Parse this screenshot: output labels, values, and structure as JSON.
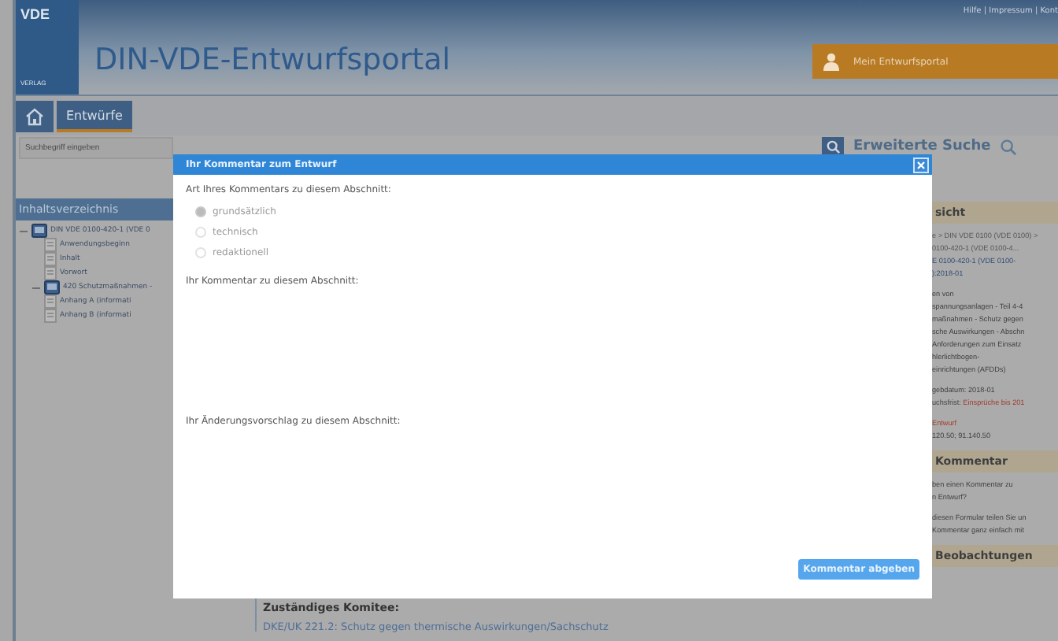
{
  "header": {
    "logo": {
      "top": "VDE",
      "bottom": "VERLAG"
    },
    "title": "DIN-VDE-Entwurfsportal",
    "top_links": "Hilfe | Impressum | Kont",
    "account_button": "Mein Entwurfsportal"
  },
  "nav": [
    {
      "kind": "home",
      "selected": false
    },
    {
      "kind": "tab",
      "label": "Entwürfe",
      "selected": true
    }
  ],
  "search": {
    "placeholder": "Suchbegriff eingeben",
    "advanced": "Erweiterte Suche"
  },
  "sidebar": {
    "title": "Inhaltsverzeichnis",
    "tree": [
      {
        "label": "DIN VDE 0100-420-1 (VDE 0",
        "kind": "document",
        "expanded": true,
        "children": [
          {
            "label": "Anwendungsbeginn",
            "kind": "page"
          },
          {
            "label": "Inhalt",
            "kind": "page"
          },
          {
            "label": "Vorwort",
            "kind": "page"
          },
          {
            "label": "420 Schutzmaßnahmen -",
            "kind": "document",
            "expanded": true
          },
          {
            "label": "Anhang A (informati",
            "kind": "page"
          },
          {
            "label": "Anhang B (informati",
            "kind": "page"
          }
        ]
      }
    ]
  },
  "right_panel": [
    {
      "title": "sicht",
      "lines": [
        {
          "kind": "muted",
          "text": "e > DIN VDE 0100 (VDE 0100) >"
        },
        {
          "kind": "muted",
          "text": "0100-420-1 (VDE 0100-4..."
        },
        {
          "kind": "link",
          "text": "E 0100-420-1 (VDE 0100-"
        },
        {
          "kind": "link",
          "text": "):2018-01"
        },
        {
          "kind": "gap"
        },
        {
          "kind": "text",
          "text": "en von"
        },
        {
          "kind": "text",
          "text": "spannungsanlagen - Teil 4-4"
        },
        {
          "kind": "text",
          "text": "maßnahmen - Schutz gegen"
        },
        {
          "kind": "text",
          "text": "sche Auswirkungen - Abschn"
        },
        {
          "kind": "text",
          "text": "Anforderungen zum Einsatz"
        },
        {
          "kind": "text",
          "text": "hlerlichtbogen-"
        },
        {
          "kind": "text",
          "text": "einrichtungen (AFDDs)"
        },
        {
          "kind": "gap"
        },
        {
          "kind": "text",
          "text": "gebdatum: 2018-01"
        },
        {
          "kind": "deadline",
          "text": "uchsfrist: ",
          "value": "Einsprüche bis 201"
        },
        {
          "kind": "gap"
        },
        {
          "kind": "warning",
          "text": "Entwurf"
        },
        {
          "kind": "text",
          "text": "120.50; 91.140.50"
        }
      ]
    },
    {
      "title": "Kommentar",
      "lines": [
        {
          "kind": "text",
          "text": "ben einen Kommentar zu"
        },
        {
          "kind": "text",
          "text": "n Entwurf?"
        },
        {
          "kind": "gap"
        },
        {
          "kind": "text",
          "text": "diesen Formular teilen Sie un"
        },
        {
          "kind": "text",
          "text": "Kommentar ganz einfach mit"
        }
      ]
    },
    {
      "title": "Beobachtungen"
    }
  ],
  "committee": {
    "label": "Zuständiges Komitee:",
    "link": "DKE/UK 221.2: Schutz gegen thermische Auswirkungen/Sachschutz"
  },
  "modal": {
    "title": "Ihr Kommentar zum Entwurf",
    "type_label": "Art Ihres Kommentars zu diesem Abschnitt:",
    "options": [
      {
        "label": "grundsätzlich",
        "selected": true
      },
      {
        "label": "technisch",
        "selected": false
      },
      {
        "label": "redaktionell",
        "selected": false
      }
    ],
    "comment_label": "Ihr Kommentar zu diesem Abschnitt:",
    "change_label": "Ihr Änderungsvorschlag zu diesem Abschnitt:",
    "submit": "Kommentar abgeben"
  }
}
